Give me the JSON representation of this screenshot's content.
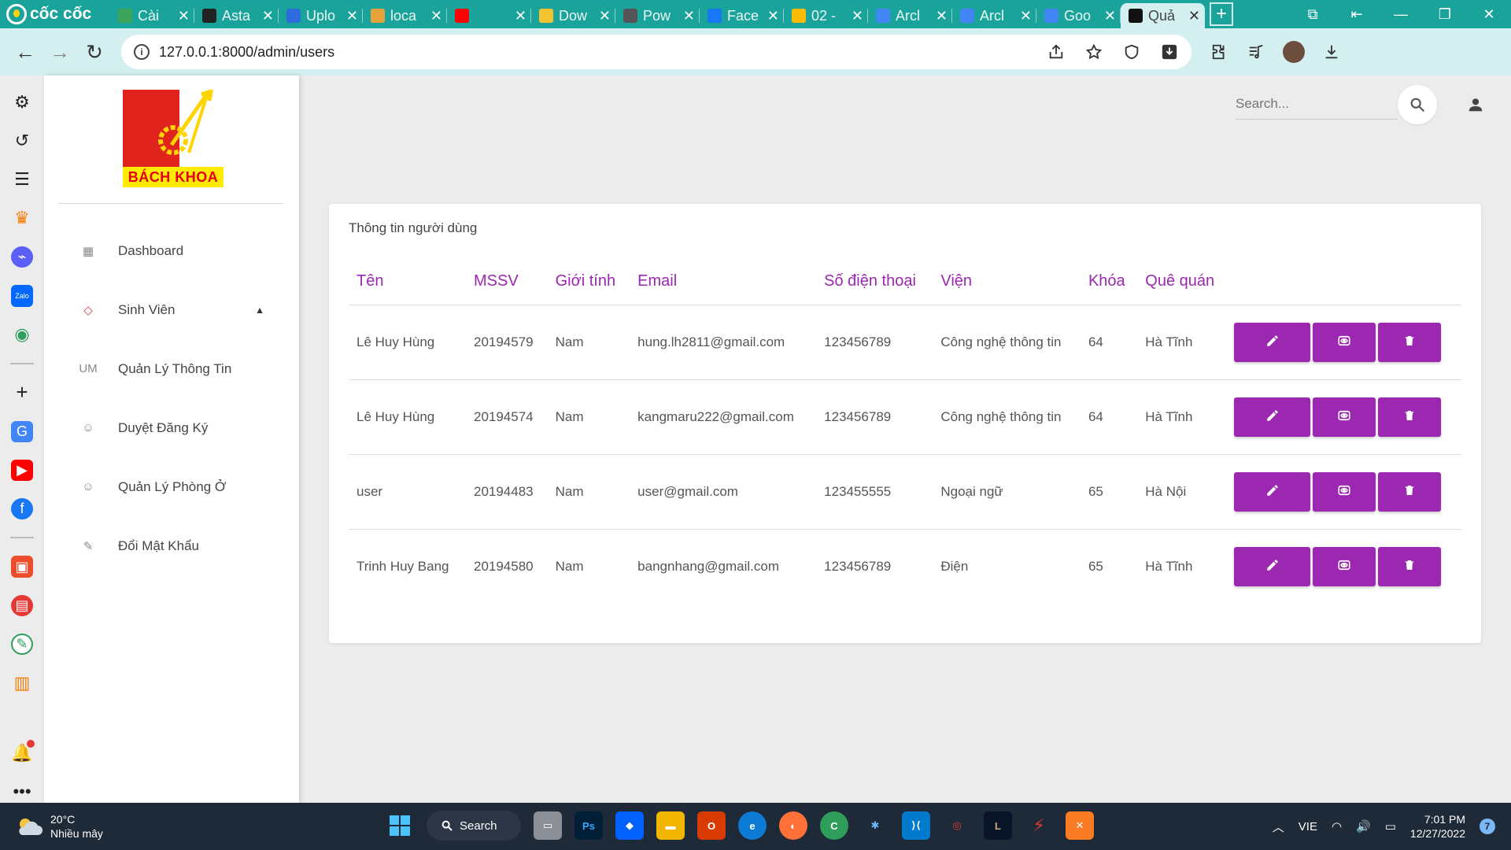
{
  "browser": {
    "brand": "cốc cốc",
    "tabs": [
      {
        "label": "Cài",
        "color": "#3ba55c"
      },
      {
        "label": "Asta",
        "color": "#222222"
      },
      {
        "label": "Uplo",
        "color": "#2d6cdf"
      },
      {
        "label": "loca",
        "color": "#e8a33a"
      },
      {
        "label": "",
        "color": "#ff0000"
      },
      {
        "label": "Dow",
        "color": "#f4c430"
      },
      {
        "label": "Pow",
        "color": "#555555"
      },
      {
        "label": "Face",
        "color": "#1877f2"
      },
      {
        "label": "02 -",
        "color": "#fbbc05"
      },
      {
        "label": "Arcl",
        "color": "#4285f4"
      },
      {
        "label": "Arcl",
        "color": "#4285f4"
      },
      {
        "label": "Goo",
        "color": "#4285f4"
      },
      {
        "label": "Quả",
        "color": "#111111",
        "active": true
      }
    ],
    "url": "127.0.0.1:8000/admin/users"
  },
  "app": {
    "logo_text": "BÁCH KHOA",
    "menu": [
      {
        "icon": "dashboard-icon",
        "glyph": "▦",
        "label": "Dashboard"
      },
      {
        "icon": "laravel-icon",
        "glyph": "◇",
        "label": "Sinh Viên",
        "caret": "▲"
      },
      {
        "icon": "um-icon",
        "glyph": "UM",
        "label": "Quản Lý Thông Tin"
      },
      {
        "icon": "person-icon",
        "glyph": "☺",
        "label": "Duyệt Đăng Ký"
      },
      {
        "icon": "person-icon",
        "glyph": "☺",
        "label": "Quản Lý Phòng Ở"
      },
      {
        "icon": "pencil-icon",
        "glyph": "✎",
        "label": "Đổi Mật Khẩu"
      }
    ],
    "search_placeholder": "Search...",
    "card_title": "Thông tin người dùng",
    "columns": [
      "Tên",
      "MSSV",
      "Giới tính",
      "Email",
      "Số điện thoại",
      "Viện",
      "Khóa",
      "Quê quán",
      ""
    ],
    "rows": [
      {
        "name": "Lê Huy Hùng",
        "mssv": "20194579",
        "gender": "Nam",
        "email": "hung.lh2811@gmail.com",
        "phone": "123456789",
        "vien": "Công nghệ thông tin",
        "khoa": "64",
        "que": "Hà Tĩnh"
      },
      {
        "name": "Lê Huy Hùng",
        "mssv": "20194574",
        "gender": "Nam",
        "email": "kangmaru222@gmail.com",
        "phone": "123456789",
        "vien": "Công nghệ thông tin",
        "khoa": "64",
        "que": "Hà Tĩnh"
      },
      {
        "name": "user",
        "mssv": "20194483",
        "gender": "Nam",
        "email": "user@gmail.com",
        "phone": "123455555",
        "vien": "Ngoại ngữ",
        "khoa": "65",
        "que": "Hà Nội"
      },
      {
        "name": "Trinh Huy Bang",
        "mssv": "20194580",
        "gender": "Nam",
        "email": "bangnhang@gmail.com",
        "phone": "123456789",
        "vien": "Điện",
        "khoa": "65",
        "que": "Hà Tĩnh"
      }
    ],
    "accent": "#9c27b0"
  },
  "taskbar": {
    "temperature": "20°C",
    "weather": "Nhiều mây",
    "search_label": "Search",
    "language": "VIE",
    "time": "7:01 PM",
    "date": "12/27/2022",
    "notification_count": "7"
  }
}
